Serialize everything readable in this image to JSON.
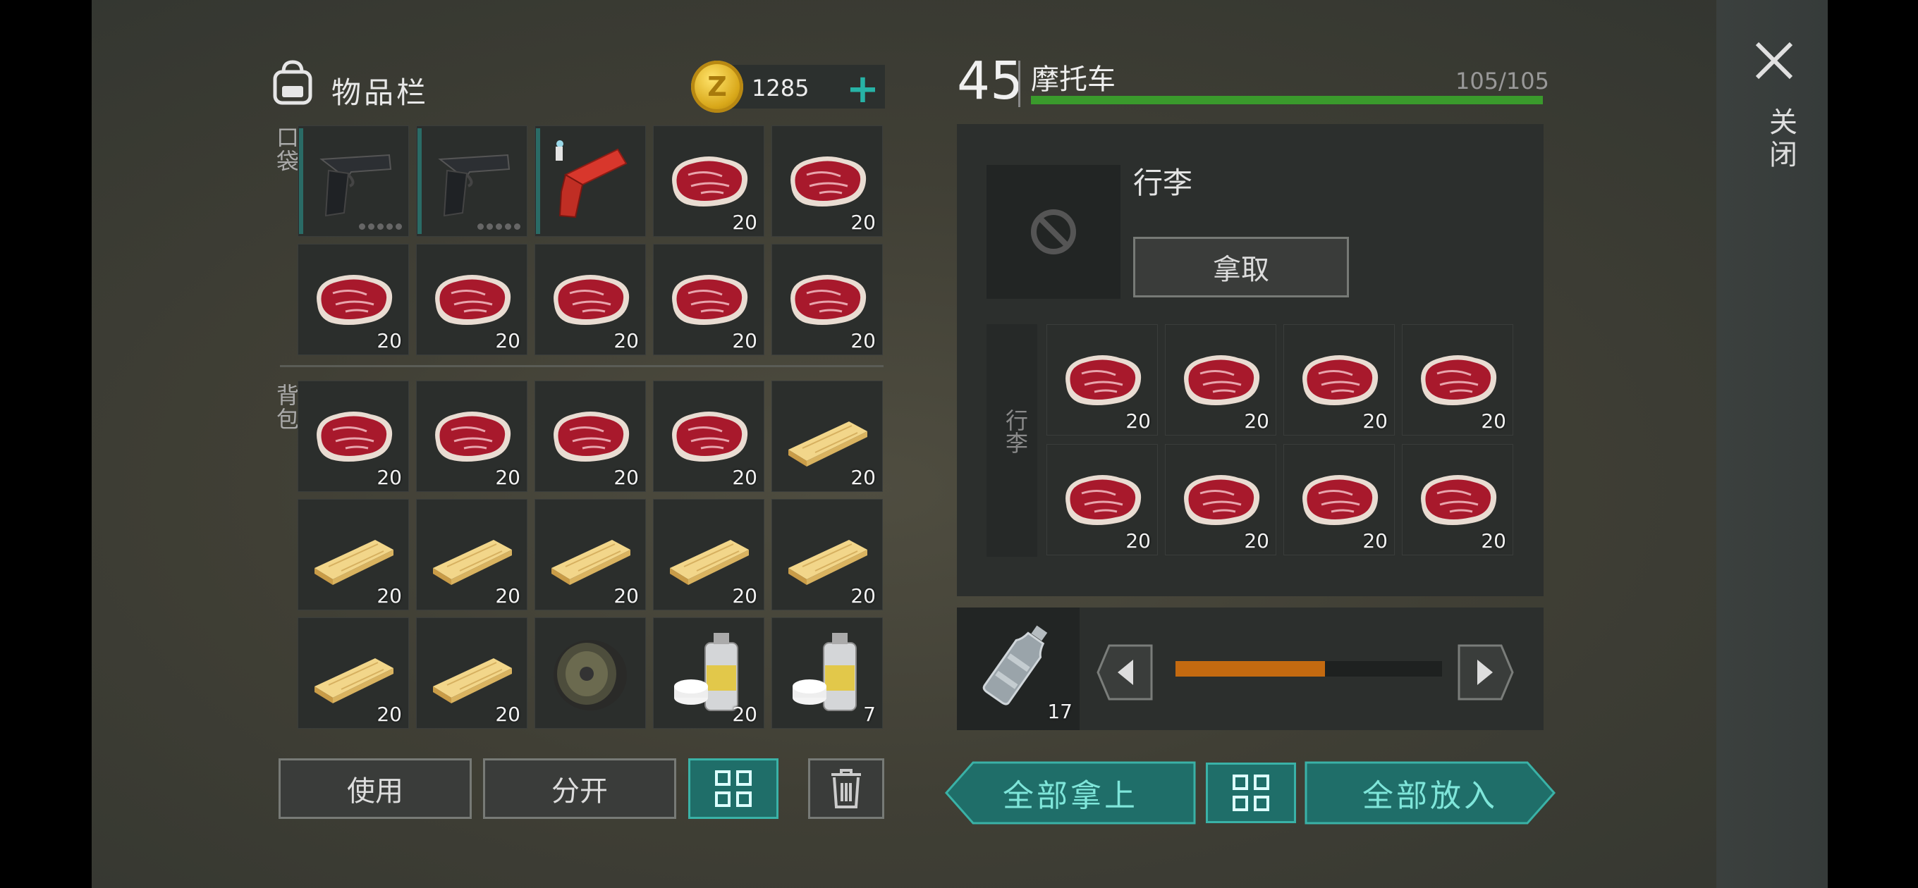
{
  "inventory": {
    "title": "物品栏",
    "coins": "1285",
    "pocket_label": "口袋",
    "backpack_label": "背包",
    "pocket": [
      {
        "item": "pistol",
        "qty": ""
      },
      {
        "item": "pistol",
        "qty": ""
      },
      {
        "item": "flare-gun",
        "qty": ""
      },
      {
        "item": "meat",
        "qty": "20"
      },
      {
        "item": "meat",
        "qty": "20"
      },
      {
        "item": "meat",
        "qty": "20"
      },
      {
        "item": "meat",
        "qty": "20"
      },
      {
        "item": "meat",
        "qty": "20"
      },
      {
        "item": "meat",
        "qty": "20"
      },
      {
        "item": "meat",
        "qty": "20"
      }
    ],
    "backpack": [
      {
        "item": "meat",
        "qty": "20"
      },
      {
        "item": "meat",
        "qty": "20"
      },
      {
        "item": "meat",
        "qty": "20"
      },
      {
        "item": "meat",
        "qty": "20"
      },
      {
        "item": "plank",
        "qty": "20"
      },
      {
        "item": "plank",
        "qty": "20"
      },
      {
        "item": "plank",
        "qty": "20"
      },
      {
        "item": "plank",
        "qty": "20"
      },
      {
        "item": "plank",
        "qty": "20"
      },
      {
        "item": "plank",
        "qty": "20"
      },
      {
        "item": "plank",
        "qty": "20"
      },
      {
        "item": "plank",
        "qty": "20"
      },
      {
        "item": "tire",
        "qty": ""
      },
      {
        "item": "spray-paint",
        "qty": "20"
      },
      {
        "item": "spray-paint",
        "qty": "7"
      }
    ],
    "use_label": "使用",
    "split_label": "分开"
  },
  "vehicle": {
    "level": "45",
    "name": "摩托车",
    "hp": "105/105",
    "luggage_title": "行李",
    "take_label": "拿取",
    "luggage_side_label": "行李",
    "luggage": [
      {
        "item": "meat",
        "qty": "20"
      },
      {
        "item": "meat",
        "qty": "20"
      },
      {
        "item": "meat",
        "qty": "20"
      },
      {
        "item": "meat",
        "qty": "20"
      },
      {
        "item": "meat",
        "qty": "20"
      },
      {
        "item": "meat",
        "qty": "20"
      },
      {
        "item": "meat",
        "qty": "20"
      },
      {
        "item": "meat",
        "qty": "20"
      }
    ],
    "fuel_qty": "17",
    "fuel_level": 0.56,
    "take_all_label": "全部拿上",
    "put_all_label": "全部放入"
  },
  "close_label": "关闭",
  "colors": {
    "accent": "#1f6e69",
    "accent_text": "#7fe6da",
    "hp_bar": "#3a9a2c",
    "fuel_bar": "#c46a10"
  }
}
